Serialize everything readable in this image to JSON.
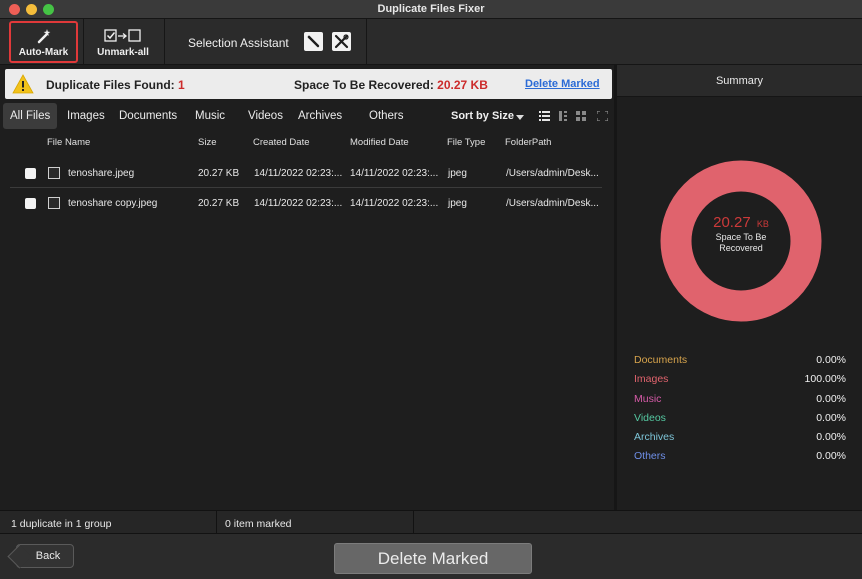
{
  "window": {
    "title": "Duplicate Files Fixer"
  },
  "toolbar": {
    "auto_mark_label": "Auto-Mark",
    "unmark_all_label": "Unmark-all",
    "selection_assistant_label": "Selection Assistant"
  },
  "info": {
    "found_label": "Duplicate Files Found:",
    "found_count": "1",
    "space_label": "Space To Be Recovered:",
    "space_value": "20.27 KB",
    "delete_link": "Delete Marked"
  },
  "tabs": [
    {
      "label": "All Files",
      "active": true
    },
    {
      "label": "Images"
    },
    {
      "label": "Documents"
    },
    {
      "label": "Music"
    },
    {
      "label": "Videos"
    },
    {
      "label": "Archives"
    },
    {
      "label": "Others"
    }
  ],
  "sort": {
    "label": "Sort by Size"
  },
  "columns": [
    "File Name",
    "Size",
    "Created Date",
    "Modified Date",
    "File Type",
    "FolderPath"
  ],
  "files": [
    {
      "name": "tenoshare.jpeg",
      "size": "20.27 KB",
      "created": "14/11/2022 02:23:...",
      "modified": "14/11/2022 02:23:...",
      "type": "jpeg",
      "path": "/Users/admin/Desk...",
      "checked": false
    },
    {
      "name": "tenoshare copy.jpeg",
      "size": "20.27 KB",
      "created": "14/11/2022 02:23:...",
      "modified": "14/11/2022 02:23:...",
      "type": "jpeg",
      "path": "/Users/admin/Desk...",
      "checked": false
    }
  ],
  "summary": {
    "title": "Summary",
    "donut_value": "20.27",
    "donut_unit": "KB",
    "donut_caption_line1": "Space To Be",
    "donut_caption_line2": "Recovered",
    "donut_color": "#e0636d",
    "categories": [
      {
        "label": "Documents",
        "value": "0.00%",
        "color": "#d6a34c"
      },
      {
        "label": "Images",
        "value": "100.00%",
        "color": "#e0636d"
      },
      {
        "label": "Music",
        "value": "0.00%",
        "color": "#d65aa8"
      },
      {
        "label": "Videos",
        "value": "0.00%",
        "color": "#55c9a2"
      },
      {
        "label": "Archives",
        "value": "0.00%",
        "color": "#7ec6d9"
      },
      {
        "label": "Others",
        "value": "0.00%",
        "color": "#6f8fe8"
      }
    ]
  },
  "status": {
    "groups": "1 duplicate in 1 group",
    "marked": "0 item marked"
  },
  "bottom": {
    "back_label": "Back",
    "delete_label": "Delete Marked"
  },
  "colors": {
    "accent_red": "#cc2b2b",
    "link_blue": "#2b6bd6"
  }
}
